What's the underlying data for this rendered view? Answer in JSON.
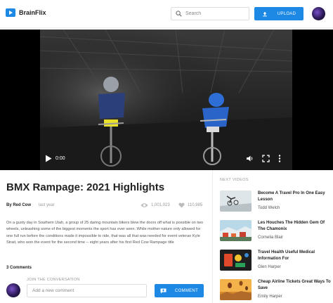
{
  "app": {
    "name": "BrainFlix",
    "brand_color": "#1e88e5"
  },
  "header": {
    "search_placeholder": "Search",
    "upload_label": "UPLOAD"
  },
  "video": {
    "current_time": "0:00",
    "scene": "Two BMX riders racing in an indoor arena under a steel roof"
  },
  "main": {
    "title": "BMX Rampage: 2021 Highlights",
    "channel": "By Red Cow",
    "posted": "last year",
    "views": "1,001,023",
    "likes": "110,985",
    "description": "On a gusty day in Southern Utah, a group of 25 daring mountain bikers blew the doors off what is possible on two wheels, unleashing some of the biggest moments the sport has ever seen. While mother nature only allowed for one full run before the conditions made it impossible to ride, that was all that was needed for event veteran Kyle Strait, who won the event for the second time -- eight years after his first Red Cow Rampage title"
  },
  "comments": {
    "count_label": "3 Comments",
    "join_label": "JOIN THE CONVERSATION",
    "input_placeholder": "Add a new comment",
    "button_label": "COMMENT"
  },
  "sidebar": {
    "heading": "NEXT VIDEOS",
    "items": [
      {
        "title": "Become A Travel Pro In One Easy Lesson",
        "author": "Todd Welch"
      },
      {
        "title": "Les Houches The Hidden Gem Of The Chamonix",
        "author": "Cornelia Blair"
      },
      {
        "title": "Travel Health Useful Medical Information For",
        "author": "Glen Harper"
      },
      {
        "title": "Cheap Airline Tickets Great Ways To Save",
        "author": "Emily Harper"
      }
    ]
  }
}
